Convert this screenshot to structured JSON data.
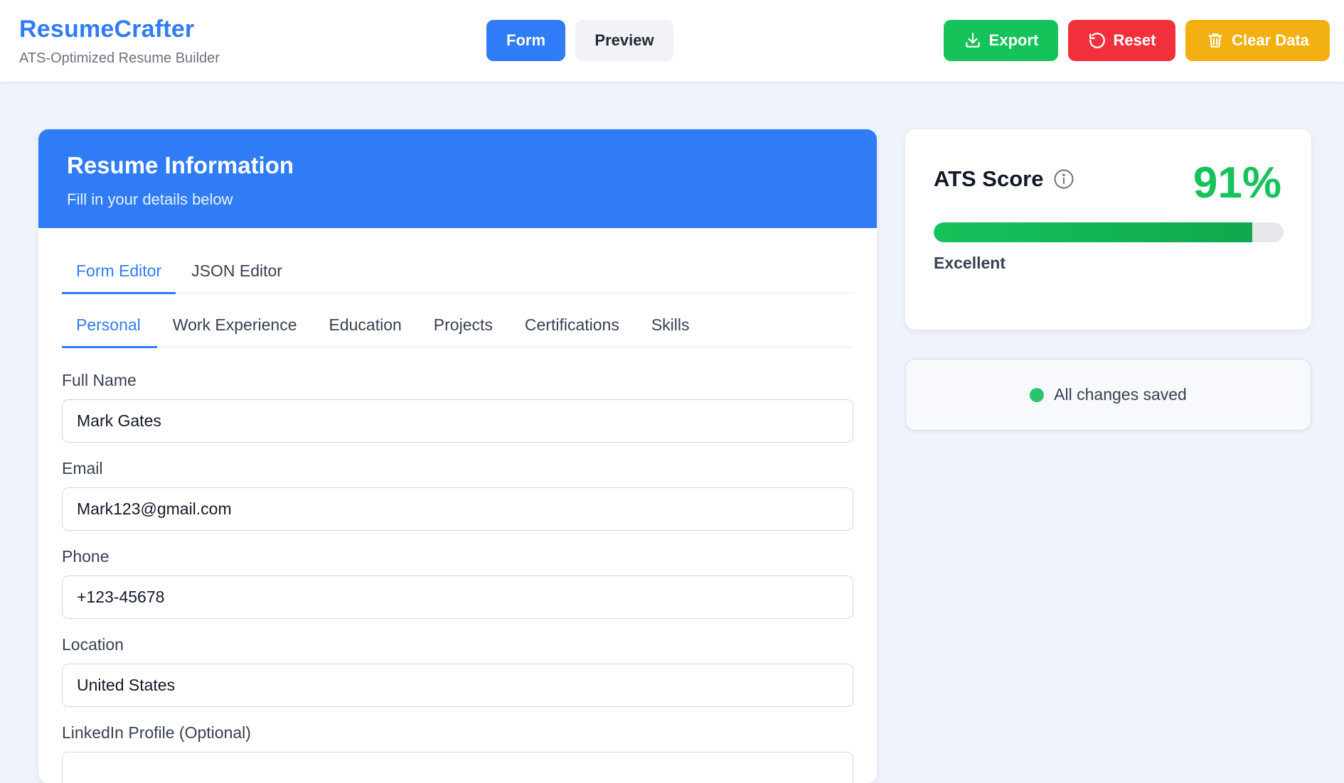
{
  "brand": {
    "title": "ResumeCrafter",
    "subtitle": "ATS-Optimized Resume Builder"
  },
  "view_toggle": {
    "form": "Form",
    "preview": "Preview",
    "active": "Form"
  },
  "actions": {
    "export": "Export",
    "reset": "Reset",
    "clear": "Clear Data"
  },
  "card": {
    "title": "Resume Information",
    "subtitle": "Fill in your details below",
    "editor_tabs": [
      "Form Editor",
      "JSON Editor"
    ],
    "section_tabs": [
      "Personal",
      "Work Experience",
      "Education",
      "Projects",
      "Certifications",
      "Skills"
    ],
    "fields": [
      {
        "label": "Full Name",
        "value": "Mark Gates"
      },
      {
        "label": "Email",
        "value": "Mark123@gmail.com"
      },
      {
        "label": "Phone",
        "value": "+123-45678"
      },
      {
        "label": "Location",
        "value": "United States"
      },
      {
        "label": "LinkedIn Profile (Optional)",
        "value": ""
      }
    ]
  },
  "ats": {
    "title": "ATS Score",
    "score_text": "91%",
    "score_fraction": 0.91,
    "grade": "Excellent"
  },
  "status": {
    "text": "All changes saved"
  },
  "colors": {
    "primary": "#2f7cf6",
    "success": "#16c25a",
    "danger": "#f1303c",
    "warning": "#f2b012"
  },
  "icons": {
    "export": "download-icon",
    "reset": "undo-icon",
    "clear": "trash-icon",
    "info": "info-icon"
  }
}
